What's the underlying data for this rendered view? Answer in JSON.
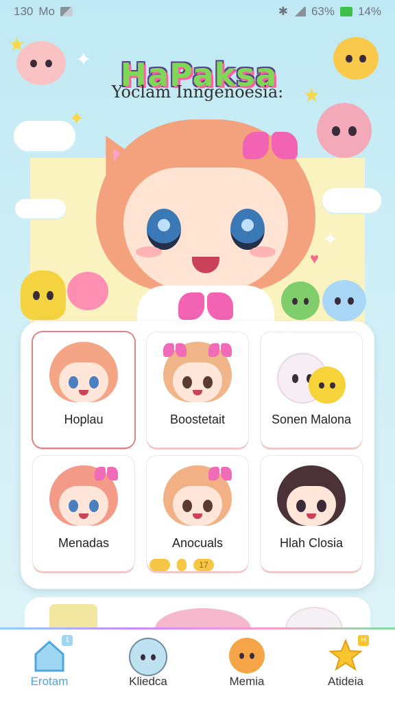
{
  "status_bar": {
    "time": "130",
    "carrier": "Mo",
    "battery_percent": "63%",
    "right_value": "14%"
  },
  "hero": {
    "logo_text": "HaPaksa",
    "subtitle": "Yoclam Inngenoesia:"
  },
  "characters": [
    {
      "label": "Hoplau",
      "selected": true
    },
    {
      "label": "Boostetait",
      "selected": false
    },
    {
      "label": "Sonen Malona",
      "selected": false
    },
    {
      "label": "Menadas",
      "selected": false
    },
    {
      "label": "Anocuals",
      "selected": false
    },
    {
      "label": "Hlah Closia",
      "selected": false
    }
  ],
  "pager": {
    "current": "17"
  },
  "bottom_nav": [
    {
      "label": "Erotam",
      "icon": "home-icon",
      "badge": "1",
      "active": true
    },
    {
      "label": "Kliedca",
      "icon": "blob-mascot-icon",
      "badge": "",
      "active": false
    },
    {
      "label": "Memia",
      "icon": "fox-mascot-icon",
      "badge": "",
      "active": false
    },
    {
      "label": "Atideia",
      "icon": "star-icon",
      "badge": "H",
      "active": false
    }
  ],
  "colors": {
    "accent_blue": "#4aa6df",
    "accent_pink": "#f263b3",
    "hero_panel": "#fbf3bf",
    "selected_border": "#d98683"
  }
}
